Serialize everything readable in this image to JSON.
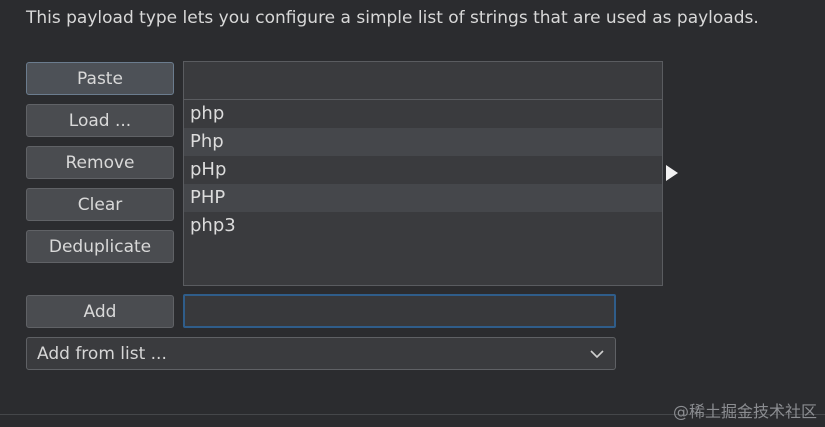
{
  "description": "This payload type lets you configure a simple list of strings that are used as payloads.",
  "buttons": {
    "paste": "Paste",
    "load": "Load ...",
    "remove": "Remove",
    "clear": "Clear",
    "deduplicate": "Deduplicate",
    "add": "Add"
  },
  "list": {
    "items": [
      "php",
      "Php",
      "pHp",
      "PHP",
      "php3"
    ]
  },
  "add_input": {
    "value": "",
    "placeholder": ""
  },
  "add_from_list": {
    "selected": "Add from list ..."
  },
  "watermark": "@稀土掘金技术社区",
  "icons": {
    "dropdown": "chevron-down-icon",
    "cursor": "mouse-pointer-icon"
  },
  "colors": {
    "background": "#2b2c2f",
    "button": "#4a4c50",
    "input_focus_border": "#2f5d8a",
    "list_alt_row": "#45474b"
  }
}
